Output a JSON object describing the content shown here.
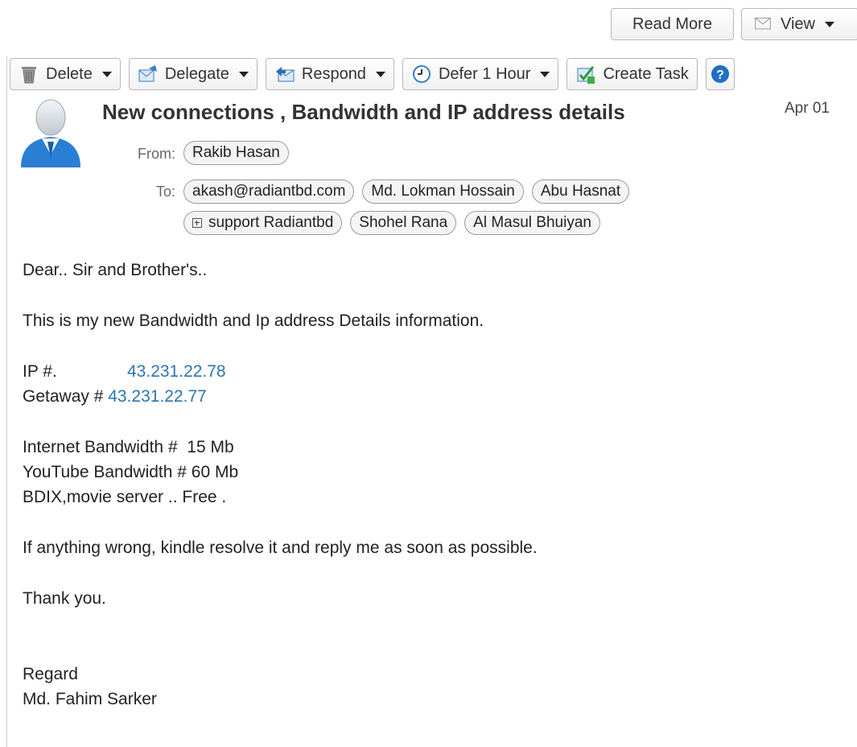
{
  "toolbar_top": {
    "read_more": "Read More",
    "view": "View"
  },
  "toolbar": [
    {
      "label": "Delete",
      "icon": "trash-icon",
      "has_dropdown": true
    },
    {
      "label": "Delegate",
      "icon": "delegate-icon",
      "has_dropdown": true
    },
    {
      "label": "Respond",
      "icon": "respond-icon",
      "has_dropdown": true
    },
    {
      "label": "Defer 1 Hour",
      "icon": "clock-icon",
      "has_dropdown": true
    },
    {
      "label": "Create Task",
      "icon": "task-check-icon",
      "has_dropdown": false
    }
  ],
  "message": {
    "subject": "New connections , Bandwidth and IP address details",
    "date": "Apr 01",
    "from_label": "From:",
    "from": "Rakib Hasan",
    "to_label": "To:",
    "to": [
      "akash@radiantbd.com",
      "Md. Lokman Hossain",
      "Abu Hasnat",
      "support Radiantbd",
      "Shohel Rana",
      "Al Masul Bhuiyan"
    ]
  },
  "body": {
    "greeting": "Dear.. Sir and Brother's..",
    "intro": "This is my new Bandwidth and Ip address Details information.",
    "ip_label": "IP #.",
    "ip_value": "43.231.22.78",
    "gateway_label": "Getaway #",
    "gateway_value": "43.231.22.77",
    "internet_bw": "Internet Bandwidth #  15 Mb",
    "youtube_bw": "YouTube Bandwidth # 60 Mb",
    "bdix": "BDIX,movie server .. Free .",
    "request": "If anything wrong, kindle resolve it and reply me as soon as possible.",
    "thanks": "Thank you.",
    "regards": "Regard",
    "signature": "Md. Fahim Sarker"
  },
  "colors": {
    "link": "#2d74b5",
    "avatar": "#2a7fd4"
  }
}
